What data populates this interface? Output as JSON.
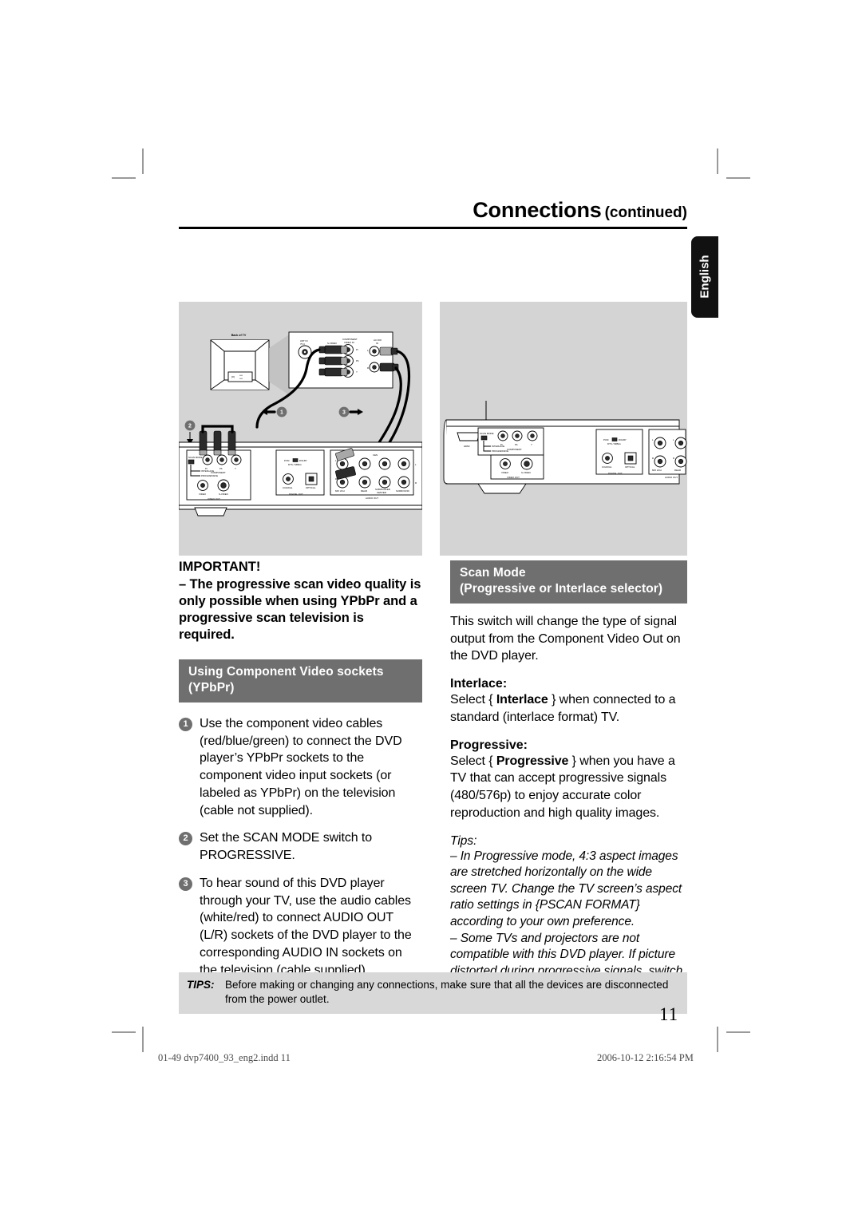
{
  "header": {
    "title": "Connections",
    "subtitle": "(continued)"
  },
  "language_tab": {
    "label": "English"
  },
  "figures": {
    "left": {
      "caption_back_of_tv": "Back of TV",
      "tv_panel_labels": {
        "ant_in": "ANT IN",
        "ant_in_ohm": "75Ω",
        "component_video_in": "COMPONENT VIDEO IN",
        "jack_pr": "Pr",
        "jack_pb": "Pb",
        "jack_y": "Y",
        "audio_in": "AUDIO IN",
        "audio_l": "L",
        "audio_r": "R"
      },
      "player_labels": {
        "scan_mode": "SCAN MODE",
        "interlace": "INTERLACE",
        "progressive": "PROGRESSIVE",
        "pr": "Pr",
        "pb": "Pb",
        "y": "Y",
        "component": "COMPONENT",
        "video": "VIDEO",
        "s_video": "S-VIDEO",
        "video_out": "VIDEO OUT",
        "pcm_dolby": "PCM / DOLBY",
        "dts_mpeg": "DTS / MPEG",
        "coaxial": "COAXIAL",
        "optical": "OPTICAL",
        "digital_out": "DIGITAL OUT",
        "mix_2ch": "MIX 2CH",
        "rear": "REAR",
        "subwoofer": "SUBWOOFER",
        "center": "CENTER",
        "surround": "SURROUND",
        "audio_out": "AUDIO OUT",
        "ch_l": "L",
        "ch_r": "R"
      },
      "markers": [
        "1",
        "2",
        "3"
      ]
    },
    "right": {
      "player_labels": {
        "hdmi": "HDMI",
        "scan_mode": "SCAN MODE",
        "interlace": "INTERLACE",
        "progressive": "PROGRESSIVE",
        "pr": "Pr",
        "pb": "Pb",
        "y": "Y",
        "component": "COMPONENT",
        "video": "VIDEO",
        "s_video": "S-VIDEO",
        "video_out": "VIDEO OUT",
        "pcm_dolby": "PCM / DOLBY",
        "dts_mpeg": "DTS / MPEG",
        "coaxial": "COAXIAL",
        "optical": "OPTICAL",
        "digital_out": "DIGITAL OUT",
        "mix_2ch": "MIX 2CH",
        "rear": "REAR",
        "audio_out": "AUDIO OUT",
        "ch_l": "L",
        "ch_r": "R"
      }
    }
  },
  "left_column": {
    "important_heading": "IMPORTANT!",
    "important_body": "– The progressive scan video quality is only possible when using YPbPr and a progressive scan television is required.",
    "band_title": "Using Component Video sockets (YPbPr)",
    "steps": [
      {
        "num": "1",
        "text": "Use the component video cables (red/blue/green) to connect the DVD player’s YPbPr sockets to the component video input sockets (or labeled as YPbPr) on the television (cable not supplied)."
      },
      {
        "num": "2",
        "text": "Set the SCAN MODE switch to PROGRESSIVE."
      },
      {
        "num": "3",
        "text": "To hear sound of this DVD player through your TV, use the audio cables (white/red) to connect AUDIO OUT (L/R) sockets of the DVD player to the corresponding AUDIO IN sockets on the television (cable supplied)."
      }
    ]
  },
  "right_column": {
    "band_line1": "Scan Mode",
    "band_line2": "(Progressive or Interlace selector)",
    "intro": "This switch will change the type of signal output from the Component Video Out on the DVD player.",
    "interlace_heading": "Interlace:",
    "interlace_body_pre": "Select { ",
    "interlace_body_bold": "Interlace",
    "interlace_body_post": " } when connected to a standard (interlace format) TV.",
    "progressive_heading": "Progressive:",
    "progressive_body_pre": "Select { ",
    "progressive_body_bold": "Progressive",
    "progressive_body_post": " } when you have a TV that can accept progressive signals (480/576p) to enjoy accurate color reproduction and high quality images.",
    "tips_label": "Tips:",
    "tip_1": "– In Progressive mode, 4:3 aspect images are stretched horizontally on the wide screen TV. Change the TV screen’s aspect ratio settings in {PSCAN FORMAT} according to your own preference.",
    "tip_2": "– Some TVs and projectors are not compatible with this DVD player. If picture distorted during progressive signals, switch the SCAN MODE to {Interlace}."
  },
  "footer": {
    "tips_word": "TIPS:",
    "tips_text": "Before making or changing any connections, make sure that all the devices are disconnected from the power outlet.",
    "page_number": "11",
    "imprint_file": "01-49 dvp7400_93_eng2.indd   11",
    "imprint_date": "2006-10-12   2:16:54 PM"
  },
  "colors": {
    "band_gray": "#6f6f6f",
    "figure_bg": "#d4d4d4",
    "tips_bar": "#d8d8d8",
    "tab_black": "#111111"
  }
}
